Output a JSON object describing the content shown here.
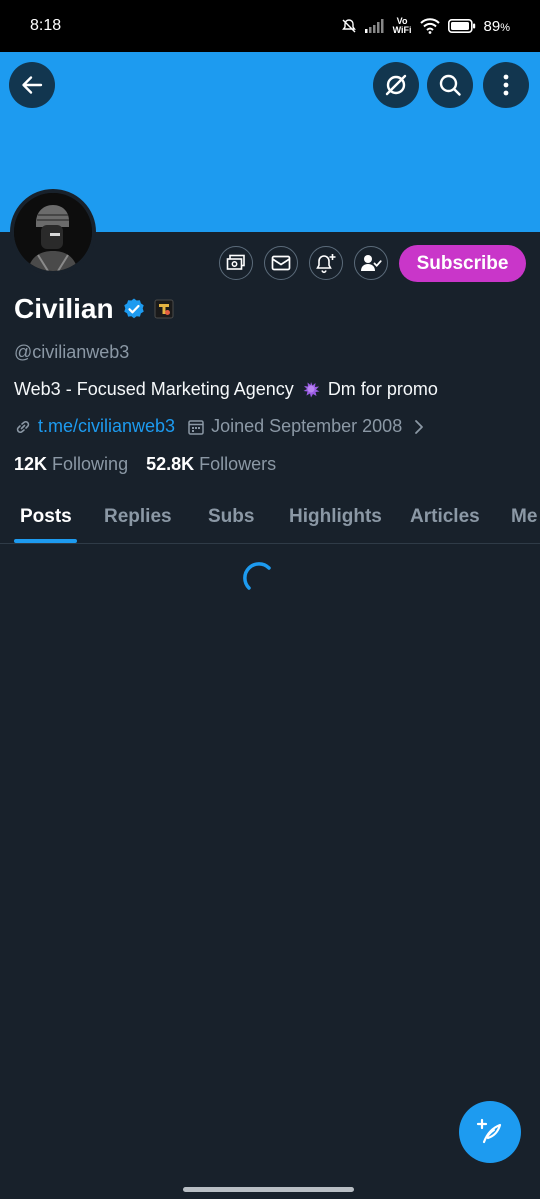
{
  "status_bar": {
    "time": "8:18",
    "network_label_top": "Vo",
    "network_label_bottom": "WiFi",
    "battery": "89",
    "battery_unit": "%"
  },
  "header": {
    "back_icon": "arrow-left-icon",
    "grok_icon": "slash-circle-icon",
    "search_icon": "search-icon",
    "more_icon": "more-vertical-icon",
    "banner_color": "#1d9bf0"
  },
  "profile": {
    "name": "Civilian",
    "handle": "@civilianweb3",
    "bio_text": "Web3 - Focused Marketing Agency",
    "bio_text_end": "Dm for promo",
    "link": "t.me/civilianweb3",
    "joined": "Joined September 2008",
    "following_count": "12K",
    "following_label": "Following",
    "followers_count": "52.8K",
    "followers_label": "Followers",
    "subscribe_label": "Subscribe",
    "subscribe_color": "#c936c9"
  },
  "tabs": [
    {
      "label": "Posts",
      "active": true
    },
    {
      "label": "Replies",
      "active": false
    },
    {
      "label": "Subs",
      "active": false
    },
    {
      "label": "Highlights",
      "active": false
    },
    {
      "label": "Articles",
      "active": false
    },
    {
      "label": "Me",
      "active": false
    }
  ],
  "accent_color": "#1d9bf0"
}
